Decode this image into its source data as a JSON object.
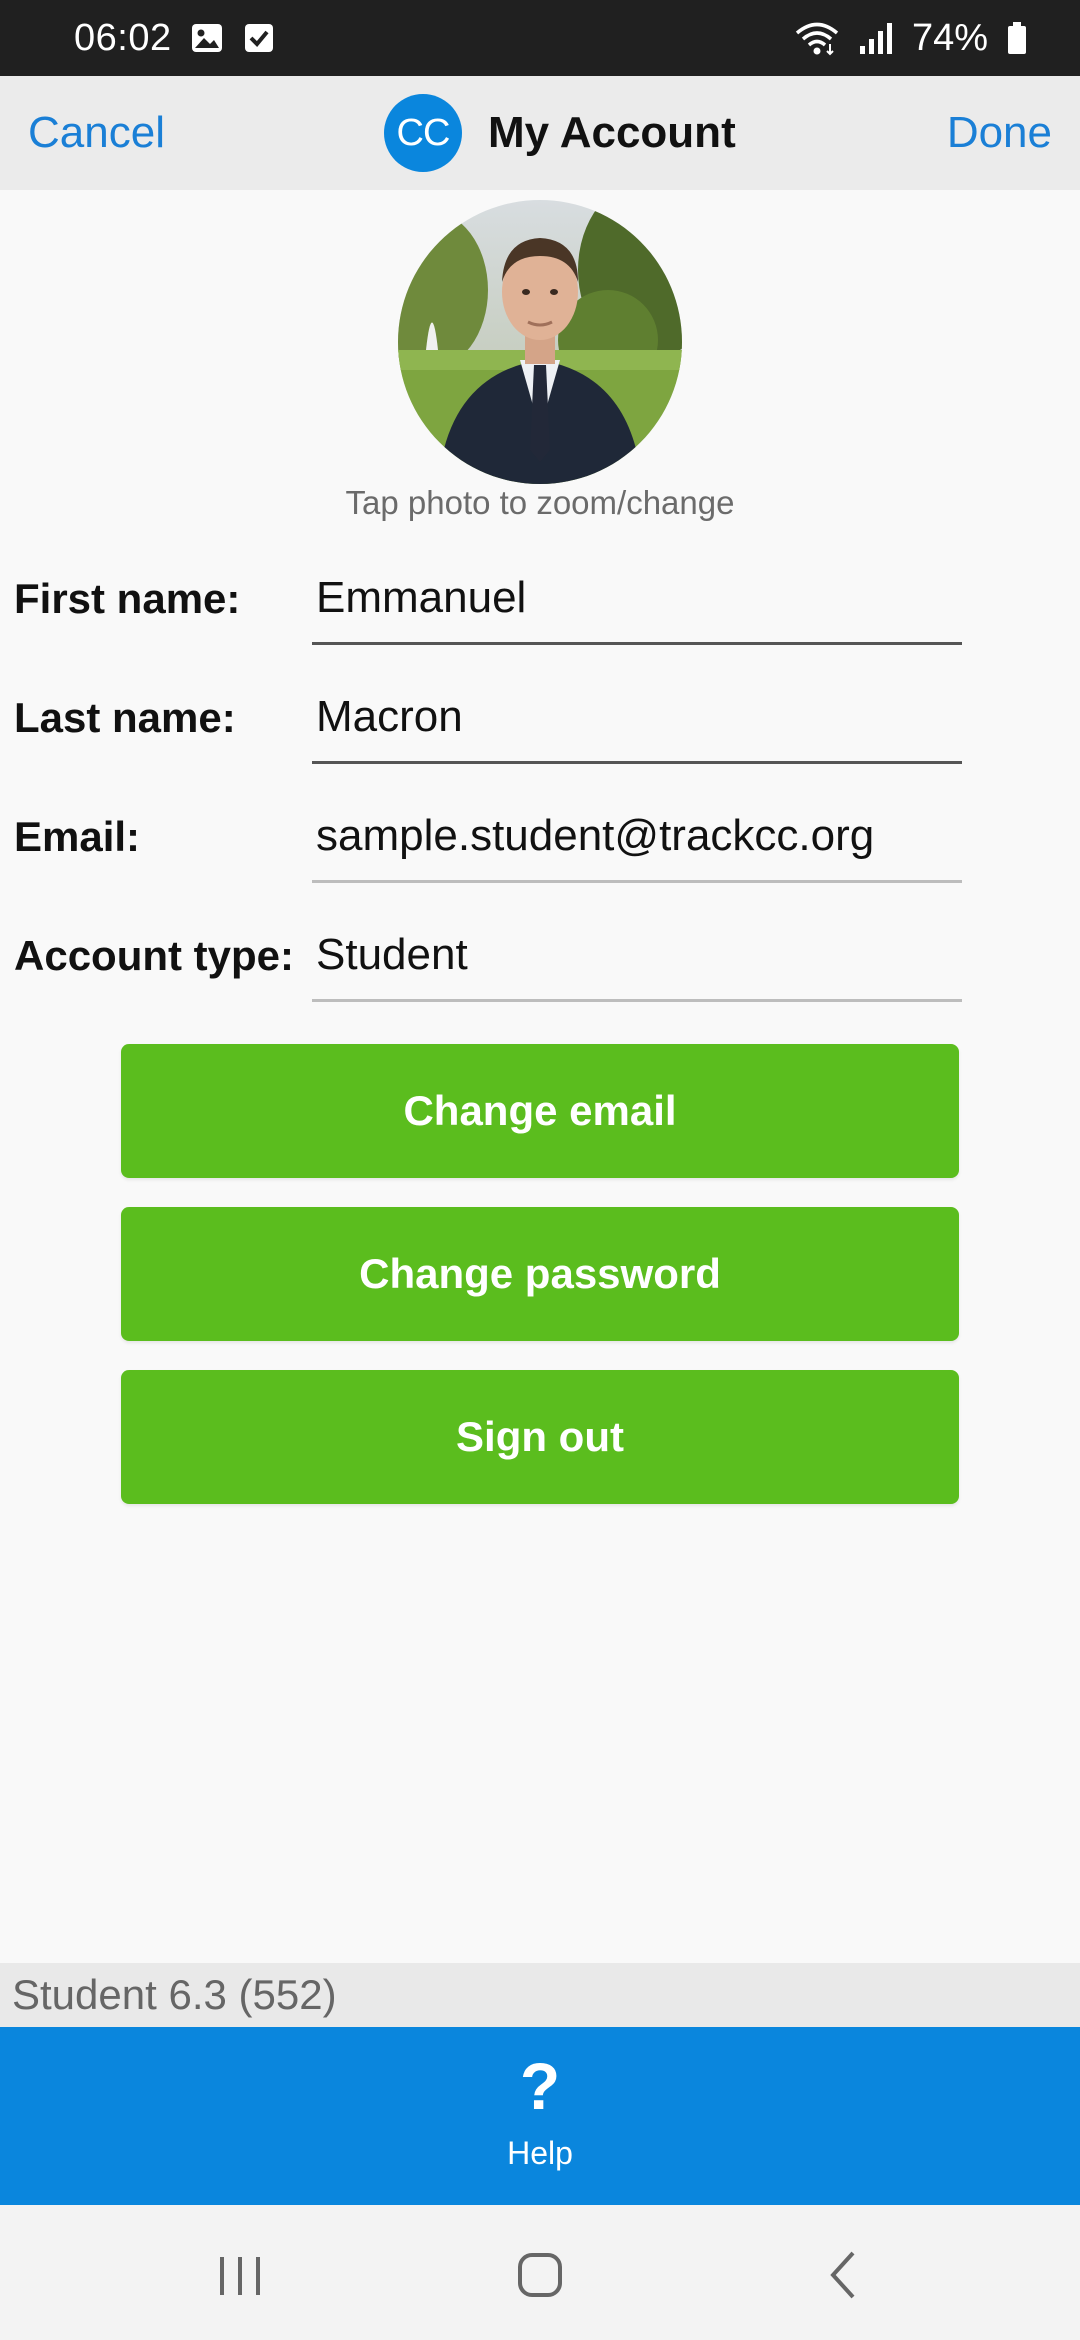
{
  "status_bar": {
    "time": "06:02",
    "battery": "74%",
    "icons": [
      "image-notification-icon",
      "check-notification-icon",
      "wifi-icon",
      "signal-icon",
      "battery-icon"
    ]
  },
  "nav": {
    "cancel": "Cancel",
    "logo": "CC",
    "title": "My Account",
    "done": "Done"
  },
  "profile": {
    "photo_caption": "Tap photo to zoom/change"
  },
  "form": {
    "first_name": {
      "label": "First name:",
      "value": "Emmanuel"
    },
    "last_name": {
      "label": "Last name:",
      "value": "Macron"
    },
    "email": {
      "label": "Email:",
      "value": "sample.student@trackcc.org"
    },
    "account_type": {
      "label": "Account type:",
      "value": "Student"
    }
  },
  "buttons": {
    "change_email": "Change email",
    "change_password": "Change password",
    "sign_out": "Sign out"
  },
  "footer": {
    "version": "Student 6.3 (552)",
    "help_icon": "?",
    "help_label": "Help"
  },
  "colors": {
    "accent_blue": "#0a86dd",
    "link_blue": "#1a7fd6",
    "button_green": "#5bbd1e"
  }
}
